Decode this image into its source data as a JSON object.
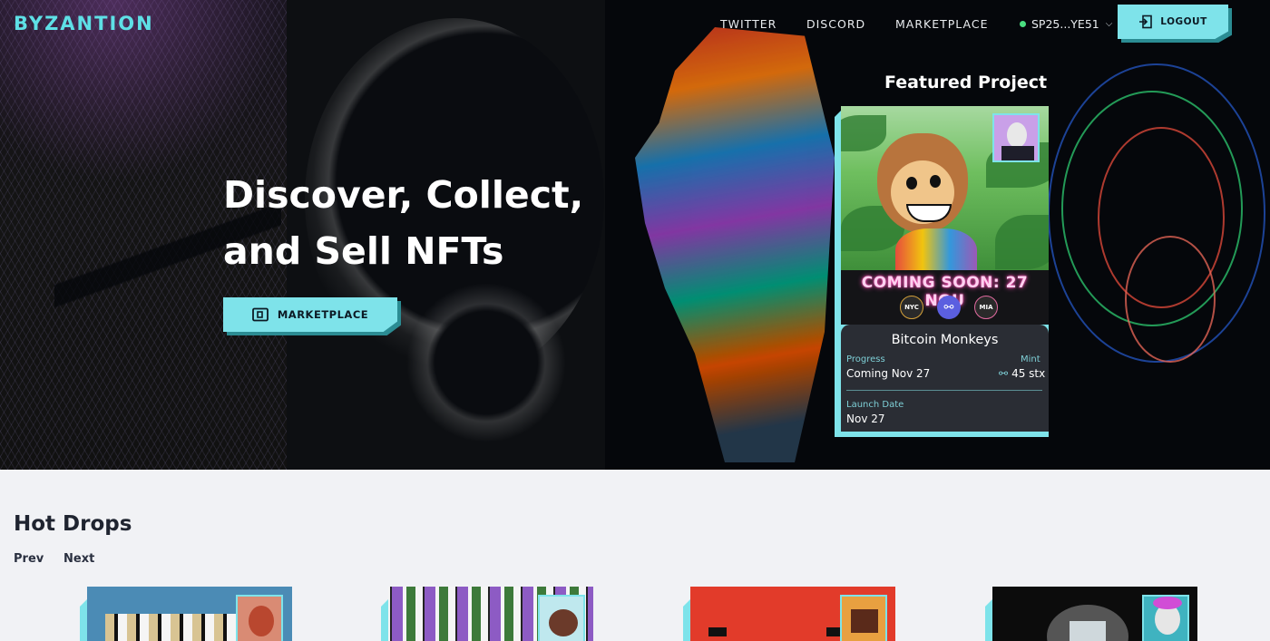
{
  "brand": {
    "logo_text": "BYZANTION",
    "accent": "#7ee3ea"
  },
  "nav": {
    "links": [
      "TWITTER",
      "DISCORD",
      "MARKETPLACE"
    ],
    "wallet": {
      "address": "SP25...YE51",
      "status_color": "#4ade80"
    },
    "logout_label": "LOGOUT"
  },
  "hero": {
    "title_line1": "Discover, Collect,",
    "title_line2": "and Sell NFTs",
    "cta_label": "MARKETPLACE"
  },
  "featured": {
    "heading": "Featured Project",
    "banner_text": "COMING SOON: 27 NOU",
    "chips": [
      {
        "label": "NYC",
        "color": "#2a2a2a"
      },
      {
        "label": "⚯",
        "color": "#5b5fe0"
      },
      {
        "label": "MIA",
        "color": "#2a2a2a"
      }
    ],
    "name": "Bitcoin Monkeys",
    "progress_label": "Progress",
    "progress_value": "Coming Nov 27",
    "mint_label": "Mint",
    "mint_value": "45 stx",
    "launch_label": "Launch Date",
    "launch_value": "Nov 27"
  },
  "hot_drops": {
    "title": "Hot Drops",
    "prev_label": "Prev",
    "next_label": "Next",
    "items": [
      {
        "bg": "#4b8bb5",
        "mini_bg": "#d98b74"
      },
      {
        "bg": "#ffffff",
        "mini_bg": "#bfe8ee"
      },
      {
        "bg": "#e23b2a",
        "mini_bg": "#e8a040"
      },
      {
        "bg": "#0c0c0c",
        "mini_bg": "#3fb3c0"
      }
    ]
  }
}
